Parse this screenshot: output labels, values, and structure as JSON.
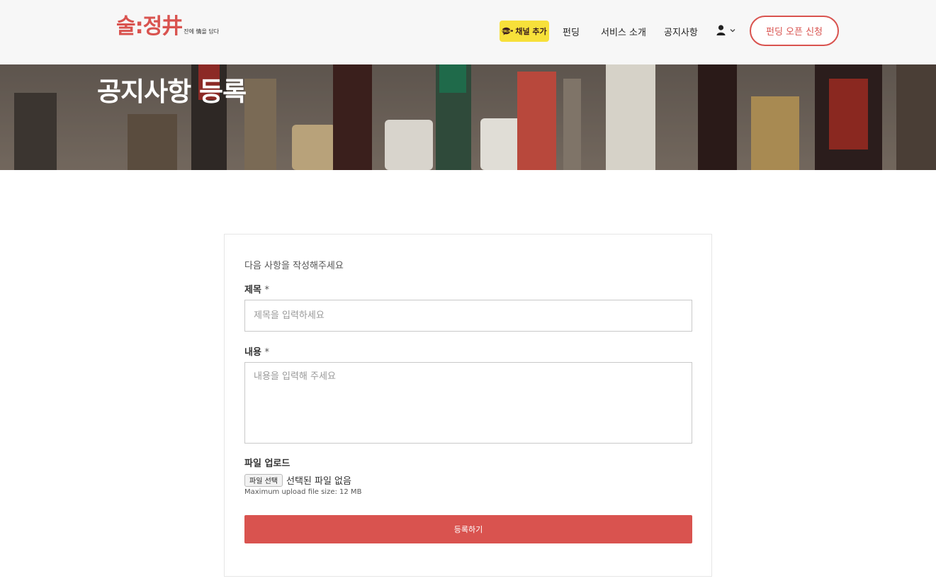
{
  "header": {
    "logo": {
      "main": "술:정井",
      "tagline": "잔에 情을 담다",
      "brand_color": "#d9534f"
    },
    "kakao_button": {
      "label": "채널 추가",
      "icon": "kakao-chat-icon",
      "color": "#f7e03a"
    },
    "nav": [
      {
        "label": "펀딩"
      },
      {
        "label": "서비스 소개"
      },
      {
        "label": "공지사항"
      }
    ],
    "user_menu": {
      "icon": "user-icon",
      "dropdown_icon": "chevron-down-icon"
    },
    "apply_button": {
      "label": "펀딩 오픈 신청"
    }
  },
  "hero": {
    "title": "공지사항 등록"
  },
  "form": {
    "intro": "다음 사항을 작성해주세요",
    "title_field": {
      "label": "제목",
      "required_mark": "*",
      "placeholder": "제목을 입력하세요",
      "value": ""
    },
    "content_field": {
      "label": "내용",
      "required_mark": "*",
      "placeholder": "내용을 입력해 주세요",
      "value": ""
    },
    "file_upload": {
      "label": "파일 업로드",
      "button_label": "파일 선택",
      "status": "선택된 파일 없음",
      "note": "Maximum upload file size: 12 MB"
    },
    "submit": {
      "label": "등록하기",
      "color": "#d9534f"
    }
  }
}
